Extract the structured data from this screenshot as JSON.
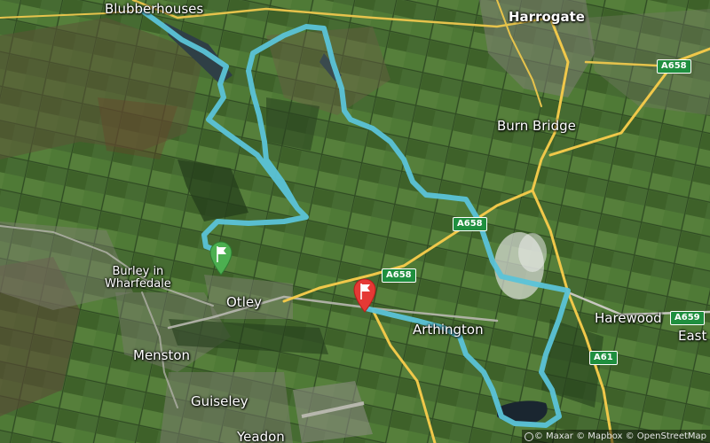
{
  "map": {
    "places": {
      "blubberhouses": "Blubberhouses",
      "harrogate": "Harrogate",
      "burn_bridge": "Burn Bridge",
      "burley_in_wharfedale": "Burley in\nWharfedale",
      "otley": "Otley",
      "menston": "Menston",
      "guiseley": "Guiseley",
      "yeadon": "Yeadon",
      "arthington": "Arthington",
      "harewood": "Harewood",
      "east_keswick": "East Ke"
    },
    "roads": {
      "a658_ne": "A658",
      "a658_mid": "A658",
      "a658_otley": "A658",
      "a659": "A659",
      "a61": "A61"
    },
    "markers": {
      "start": "green-flag",
      "finish": "red-flag"
    },
    "route_color": "#5bc3d8",
    "attribution": "© Maxar © Mapbox © OpenStreetMap"
  }
}
